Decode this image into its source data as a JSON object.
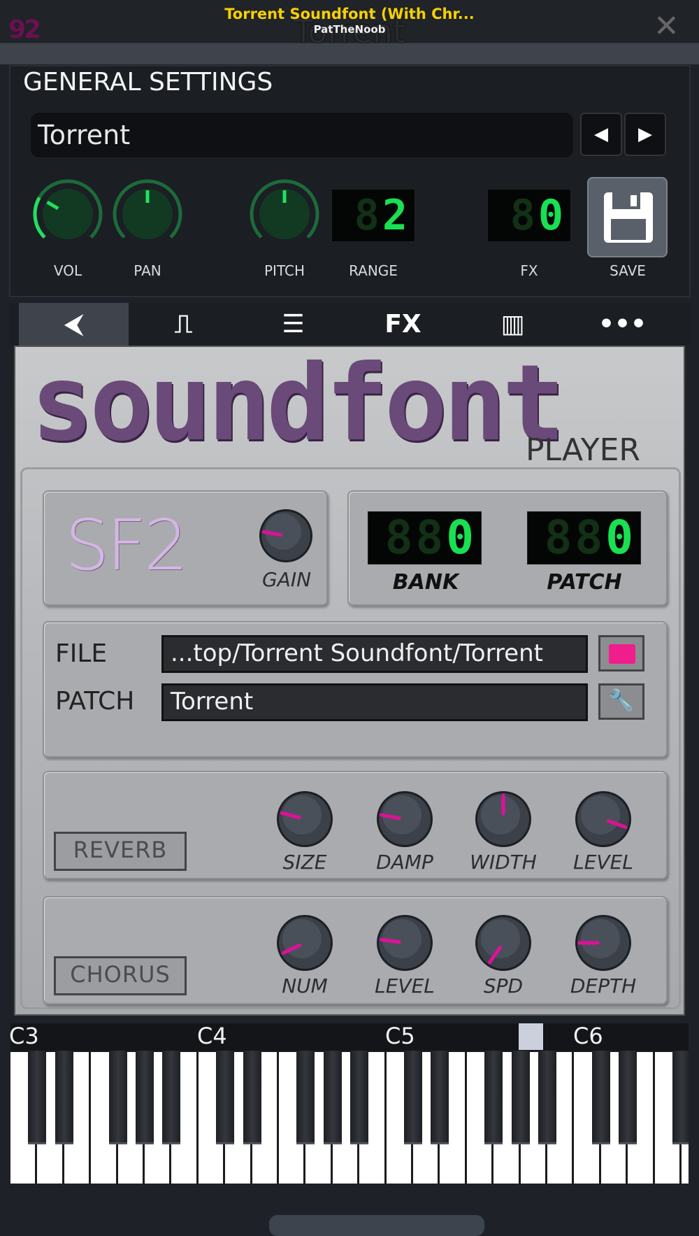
{
  "window": {
    "title": "Torrent Soundfont (With Chr...",
    "subtitle": "PatTheNoob",
    "ghost_title": "Torrent",
    "logo": "92",
    "close_icon": "close-icon"
  },
  "general": {
    "heading": "GENERAL SETTINGS",
    "preset": "Torrent",
    "prev": "◀",
    "next": "▶",
    "knobs": [
      {
        "label": "VOL",
        "angle": -60
      },
      {
        "label": "PAN",
        "angle": 0
      },
      {
        "label": "PITCH",
        "angle": 0
      }
    ],
    "range": {
      "label": "RANGE",
      "value": "2",
      "dim": "8"
    },
    "fx": {
      "label": "FX",
      "value": "0",
      "dim": "8"
    },
    "save": "SAVE"
  },
  "tabs": [
    {
      "icon": "plug-icon",
      "glyph": "⮜"
    },
    {
      "icon": "envelope-icon",
      "glyph": "⎍"
    },
    {
      "icon": "lines-icon",
      "glyph": "☰"
    },
    {
      "icon": "fx-icon",
      "glyph": "FX"
    },
    {
      "icon": "piano-icon",
      "glyph": "▥"
    },
    {
      "icon": "more-icon",
      "glyph": "•••"
    }
  ],
  "plugin": {
    "title": "soundfont",
    "subtitle": "PLAYER",
    "sf2_logo": "SF2",
    "gain": {
      "label": "GAIN",
      "angle": -80
    },
    "bank": {
      "label": "BANK",
      "value": "0",
      "dim": "88"
    },
    "patch_num": {
      "label": "PATCH",
      "value": "0",
      "dim": "88"
    },
    "file_label": "FILE",
    "file_value": "...top/Torrent Soundfont/Torrent",
    "patch_label": "PATCH",
    "patch_value": "Torrent",
    "reverb": {
      "button": "REVERB",
      "knobs": [
        {
          "label": "SIZE",
          "angle": -75
        },
        {
          "label": "DAMP",
          "angle": -80
        },
        {
          "label": "WIDTH",
          "angle": 0
        },
        {
          "label": "LEVEL",
          "angle": 110
        }
      ]
    },
    "chorus": {
      "button": "CHORUS",
      "knobs": [
        {
          "label": "NUM",
          "angle": -115
        },
        {
          "label": "LEVEL",
          "angle": -82
        },
        {
          "label": "SPD",
          "angle": -145
        },
        {
          "label": "DEPTH",
          "angle": -90
        }
      ]
    },
    "accent": "#e0109a"
  },
  "keyboard": {
    "octaves": [
      "C3",
      "C4",
      "C5",
      "C6"
    ],
    "lcd_on": "#19e052",
    "accent": "#1fe060"
  }
}
